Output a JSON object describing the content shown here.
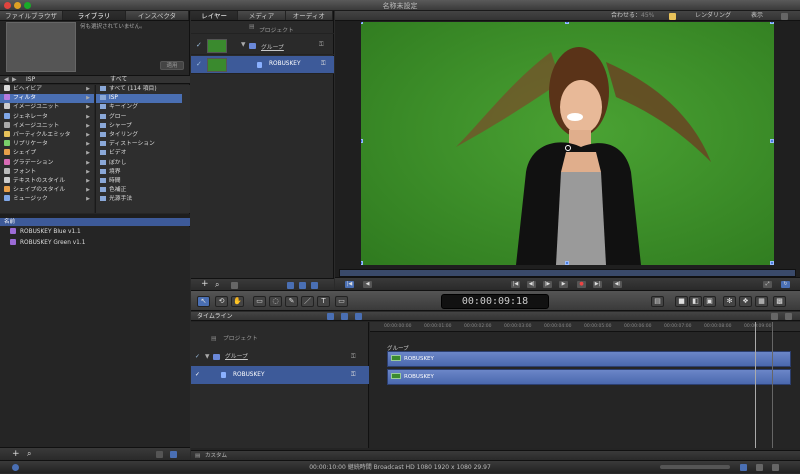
{
  "window": {
    "title": "名称未設定"
  },
  "left_panel": {
    "tabs": [
      "ファイルブラウザ",
      "ライブラリ",
      "インスペクタ"
    ],
    "preview_message": "何も選択されていません。",
    "apply_label": "適用",
    "crumb": "ISP",
    "filter": "すべて",
    "categories": [
      {
        "label": "ビヘイビア",
        "color": "#d9d9d9"
      },
      {
        "label": "フィルタ",
        "color": "#b57be0"
      },
      {
        "label": "イメージユニット",
        "color": "#ccc"
      },
      {
        "label": "ジェネレータ",
        "color": "#7fa7e8"
      },
      {
        "label": "イメージユニット",
        "color": "#aaa"
      },
      {
        "label": "パーティクルエミッタ",
        "color": "#e8c25a"
      },
      {
        "label": "リプリケータ",
        "color": "#7ad16b"
      },
      {
        "label": "シェイプ",
        "color": "#e8a04a"
      },
      {
        "label": "グラデーション",
        "color": "#d96bb5"
      },
      {
        "label": "フォント",
        "color": "#bbb"
      },
      {
        "label": "テキストのスタイル",
        "color": "#ccc"
      },
      {
        "label": "シェイプのスタイル",
        "color": "#e8a04a"
      },
      {
        "label": "ミュージック",
        "color": "#7fa7e8"
      }
    ],
    "subcategories": [
      "すべて (114 項目)",
      "ISP",
      "キーイング",
      "グロー",
      "シャープ",
      "タイリング",
      "ディストーション",
      "ビデオ",
      "ぼかし",
      "境界",
      "時間",
      "色補正",
      "光源手法"
    ],
    "results_header": "名前",
    "results": [
      "ROBUSKEY Blue v1.1",
      "ROBUSKEY Green v1.1"
    ]
  },
  "layers_panel": {
    "tabs": [
      "レイヤー",
      "メディア",
      "オーディオ"
    ],
    "project_label": "プロジェクト",
    "group_label": "グループ",
    "layer_label": "ROBUSKEY"
  },
  "canvas": {
    "fit_label": "合わせる：",
    "fit_value": "45%",
    "render_label": "レンダリング",
    "view_label": "表示"
  },
  "toolbar": {
    "timecode": "00:00:09:18"
  },
  "timeline": {
    "title": "タイムライン",
    "project_label": "プロジェクト",
    "group_label": "グループ",
    "layer_label": "ROBUSKEY",
    "ruler": [
      "00:00:00:00",
      "00:00:01:00",
      "00:00:02:00",
      "00:00:03:00",
      "00:00:04:00",
      "00:00:05:00",
      "00:00:06:00",
      "00:00:07:00",
      "00:00:08:00",
      "00:00:09:00"
    ],
    "bar_group": "グループ",
    "bar1": "ROBUSKEY",
    "bar2": "ROBUSKEY",
    "footer": "カスタム"
  },
  "status": {
    "text": "00:00:10:00 継続時間 Broadcast HD 1080 1920 x 1080 29.97"
  }
}
